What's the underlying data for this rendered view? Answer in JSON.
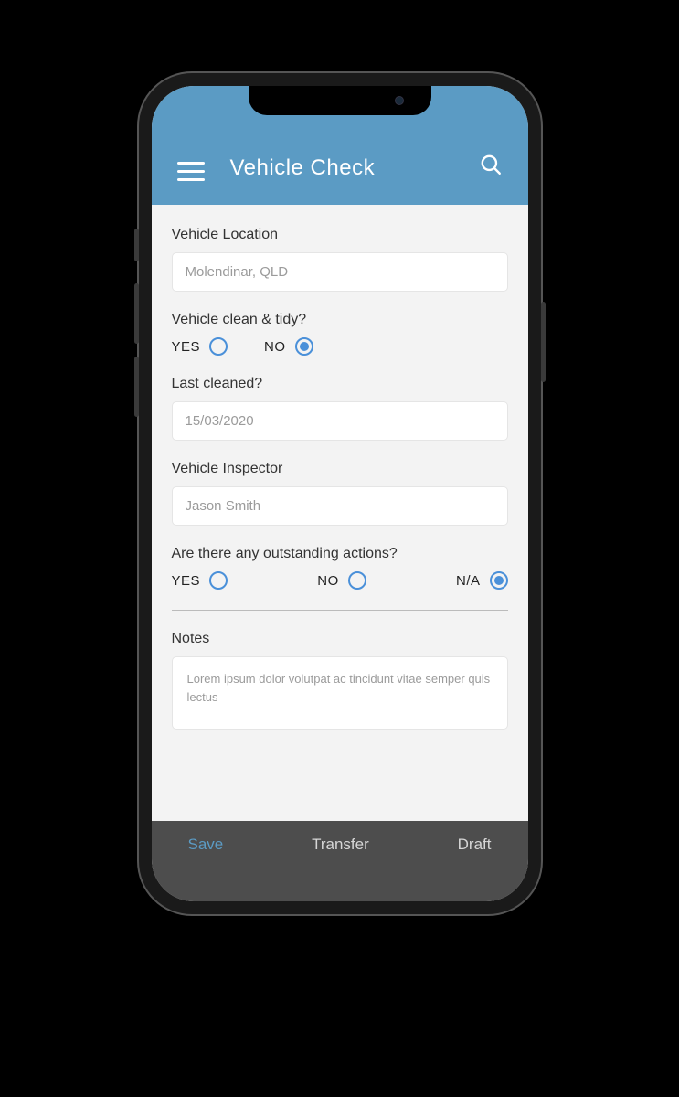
{
  "header": {
    "title": "Vehicle Check"
  },
  "form": {
    "location": {
      "label": "Vehicle Location",
      "value": "Molendinar, QLD"
    },
    "clean": {
      "label": "Vehicle clean & tidy?",
      "options": {
        "yes": "YES",
        "no": "NO"
      },
      "selected": "no"
    },
    "last_cleaned": {
      "label": "Last cleaned?",
      "value": "15/03/2020"
    },
    "inspector": {
      "label": "Vehicle Inspector",
      "value": "Jason Smith"
    },
    "outstanding": {
      "label": "Are there any outstanding actions?",
      "options": {
        "yes": "YES",
        "no": "NO",
        "na": "N/A"
      },
      "selected": "na"
    },
    "notes": {
      "label": "Notes",
      "value": "Lorem ipsum dolor volutpat ac tincidunt vitae semper quis lectus"
    }
  },
  "footer": {
    "save": "Save",
    "transfer": "Transfer",
    "draft": "Draft"
  }
}
